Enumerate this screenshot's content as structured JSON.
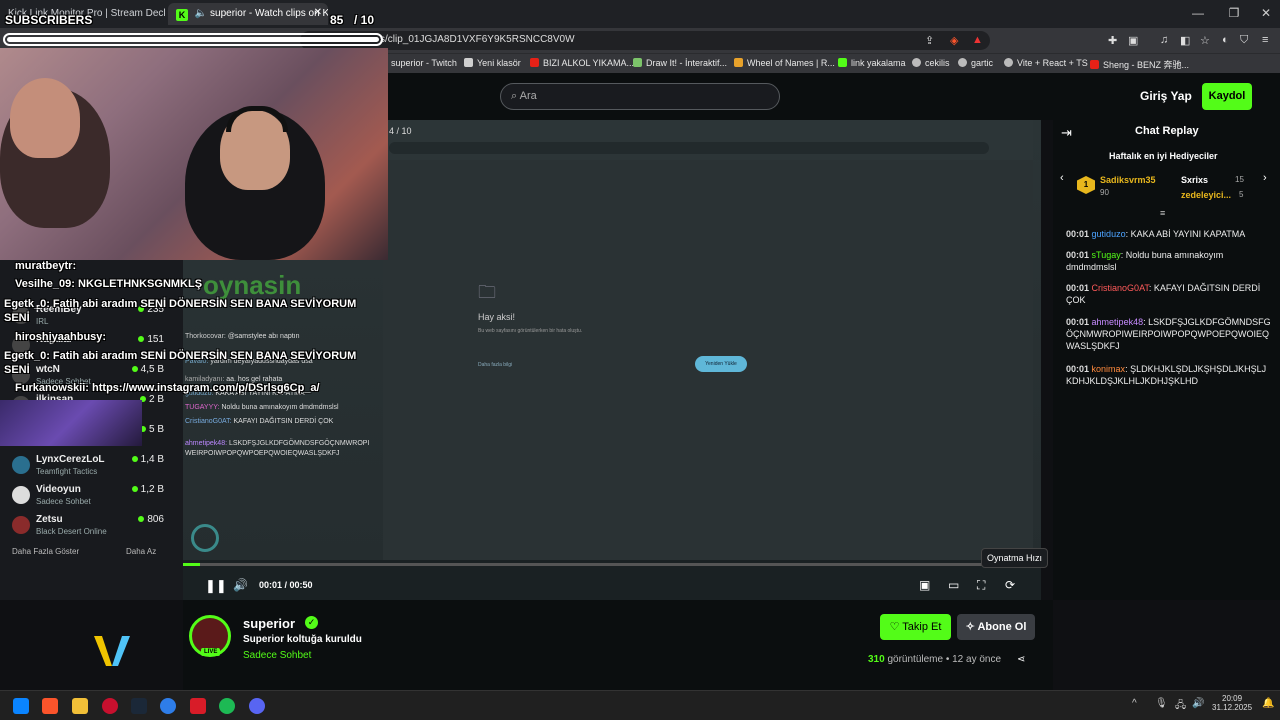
{
  "browser": {
    "tabs": [
      {
        "title": "Kick Link Monitor Pro | Stream Deck"
      },
      {
        "title": "superior - Watch clips on Kick"
      }
    ],
    "url": "kick.com/superior/clips/clip_01JGJA8D1VXF6Y9K5RSNCC8V0W",
    "url_visible": "s/clip_01JGJA8D1VXF6Y9K5RSNCC8V0W",
    "bookmarks": [
      {
        "label": "superior - Twitch",
        "color": "#9146ff"
      },
      {
        "label": "Yeni klasör",
        "color": "#cfcfcf"
      },
      {
        "label": "BIZI ALKOL YIKAMA...",
        "color": "#e62117"
      },
      {
        "label": "Draw It! - İnteraktif...",
        "color": "#7cc46a"
      },
      {
        "label": "Wheel of Names | R...",
        "color": "#e8a22b"
      },
      {
        "label": "link yakalama",
        "color": "#53fc18"
      },
      {
        "label": "cekilis",
        "color": "#bbbbbb"
      },
      {
        "label": "gartic",
        "color": "#bbbbbb"
      },
      {
        "label": "Vite + React + TS",
        "color": "#bbbbbb"
      },
      {
        "label": "Sheng - BENZ 奔驰...",
        "color": "#e62117"
      }
    ]
  },
  "overlay": {
    "subscribers_label": "SUBSCRIBERS",
    "subscribers_count": "85",
    "subscribers_goal": "/ 10",
    "sub_progress": 1.0,
    "chat_lines": [
      {
        "user": "muratbeytr:",
        "text": ""
      },
      {
        "user": "Vesilhe_09:",
        "text": "NKGLETHNKSGNMKLŞ"
      },
      {
        "user": "Egetk_0:",
        "text": "Fatih abi aradım SENİ DÖNERSİN SEN BANA SEVİYORUM SENİ"
      },
      {
        "user": "hiroshiyaahbusy:",
        "text": ""
      },
      {
        "user": "Egetk_0:",
        "text": "Fatih abi aradım SENİ DÖNERSİN SEN BANA SEVİYORUM SENİ"
      },
      {
        "user": "Furkanowskii:",
        "text": "https://www.instagram.com/p/DSrlsg6Cp_a/"
      }
    ]
  },
  "kick": {
    "search_placeholder": "Ara",
    "login_label": "Giriş Yap",
    "signup_label": "Kaydol",
    "sidebar_channels": [
      {
        "name": "ReemBey",
        "category": "IRL",
        "viewers": "235"
      },
      {
        "name": "Nagalar",
        "category": "",
        "viewers": "151"
      },
      {
        "name": "wtcN",
        "category": "Sadece Sohbet",
        "viewers": "4,5 B"
      },
      {
        "name": "ilkinsan",
        "category": "",
        "viewers": "2 B"
      },
      {
        "name": "",
        "category": "",
        "viewers": "5 B"
      },
      {
        "name": "LynxCerezLoL",
        "category": "Teamfight Tactics",
        "viewers": "1,4 B"
      },
      {
        "name": "Videoyun",
        "category": "Sadece Sohbet",
        "viewers": "1,2 B"
      },
      {
        "name": "Zetsu",
        "category": "Black Desert Online",
        "viewers": "806"
      }
    ],
    "sidebar_more": "Daha Fazla Göster",
    "sidebar_less": "Daha Az",
    "player": {
      "time_current": "00:01",
      "time_total": "00:50",
      "progress": 0.02,
      "tooltip": "Oynatma Hızı",
      "inner_page_counter": "4 / 10",
      "inner_error_title": "Hay aksi!",
      "inner_error_desc": "Bu web sayfasını görüntülerken bir hata oluştu.",
      "inner_button": "Yeniden Yükle",
      "inner_link": "Daha fazla bilgi",
      "inner_logo": "oynasin",
      "inner_chat": [
        {
          "user": "Thorkocovar:",
          "text": "@samstylee abı naptın"
        },
        {
          "user": "Paval0:",
          "text": "yardım deyafyadusshdaydas dsa"
        },
        {
          "user": "kamiladyanı:",
          "text": "aa. hos gel rahata"
        },
        {
          "user": "gutiduzo:",
          "text": "KAKA ABİ YAYINI KAPATMA"
        },
        {
          "user": "TUGAYYY:",
          "text": "Noldu buna amınakoyım dmdmdmslsl"
        },
        {
          "user": "CristianoG0AT:",
          "text": "KAFAYI DAĞITSIN DERDİ ÇOK"
        },
        {
          "user": "ahmetipek48:",
          "text": "LSKDFŞJGLKDFGÖMNDSFGÖÇNMWROPI WEIRPOIWPOPQWPOEPQWOIEQWASLŞDKFJ"
        }
      ]
    },
    "chat": {
      "title": "Chat Replay",
      "gifters_title": "Haftalık en iyi Hediyeciler",
      "gifters": [
        {
          "rank": "1",
          "name": "Sadiksvrm35",
          "count": "90"
        },
        {
          "rank": "",
          "name": "Sxrixs",
          "count": "15"
        },
        {
          "rank": "",
          "name": "zedeleyici...",
          "count": "5"
        }
      ],
      "messages": [
        {
          "time": "00:01",
          "user": "gutiduzo",
          "color": "#4da3ff",
          "text": "KAKA ABİ YAYINI KAPATMA"
        },
        {
          "time": "00:01",
          "user": "sTugay",
          "color": "#53fc18",
          "text": "Noldu buna amınakoyım dmdmdmslsl"
        },
        {
          "time": "00:01",
          "user": "CristianoG0AT",
          "color": "#ff5a5a",
          "text": "KAFAYI DAĞITSIN DERDİ ÇOK"
        },
        {
          "time": "00:01",
          "user": "ahmetipek48",
          "color": "#c78bff",
          "text": "LSKDFŞJGLKDFGÖMNDSFGÖÇNMWROPIWEIRPOIWPOPQWPOEPQWOIEQWASLŞDKFJ"
        },
        {
          "time": "00:01",
          "user": "konimax",
          "color": "#ff8a3d",
          "text": "ŞLDKHJKLŞDLJKŞHŞDLJKHŞLJKDHJKLDŞJKLHLJKDHJŞKLHD"
        }
      ]
    },
    "streamer": {
      "name": "superior",
      "title": "Superior koltuğa kuruldu",
      "category": "Sadece Sohbet",
      "live_badge": "LIVE",
      "follow_label": "Takip Et",
      "subscribe_label": "Abone Ol",
      "views_count": "310",
      "views_label": "görüntüleme",
      "age": "12 ay önce"
    }
  },
  "taskbar": {
    "time": "20:09",
    "date": "31.12.2025"
  },
  "colors": {
    "kick_green": "#53fc18",
    "background": "#0b0e0f"
  }
}
